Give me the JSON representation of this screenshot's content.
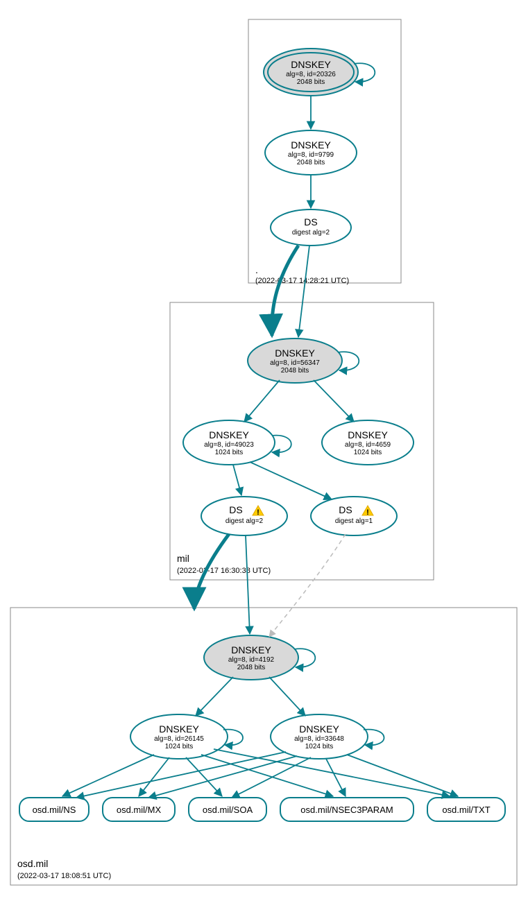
{
  "zones": {
    "root": {
      "label": ".",
      "ts": "(2022-03-17 14:28:21 UTC)"
    },
    "mil": {
      "label": "mil",
      "ts": "(2022-03-17 16:30:38 UTC)"
    },
    "osd": {
      "label": "osd.mil",
      "ts": "(2022-03-17 18:08:51 UTC)"
    }
  },
  "nodes": {
    "root_ksk": {
      "title": "DNSKEY",
      "l1": "alg=8, id=20326",
      "l2": "2048 bits"
    },
    "root_zsk": {
      "title": "DNSKEY",
      "l1": "alg=8, id=9799",
      "l2": "2048 bits"
    },
    "root_ds": {
      "title": "DS",
      "l1": "digest alg=2"
    },
    "mil_ksk": {
      "title": "DNSKEY",
      "l1": "alg=8, id=56347",
      "l2": "2048 bits"
    },
    "mil_zsk": {
      "title": "DNSKEY",
      "l1": "alg=8, id=49023",
      "l2": "1024 bits"
    },
    "mil_zsk2": {
      "title": "DNSKEY",
      "l1": "alg=8, id=4659",
      "l2": "1024 bits"
    },
    "mil_ds2": {
      "title": "DS",
      "l1": "digest alg=2"
    },
    "mil_ds1": {
      "title": "DS",
      "l1": "digest alg=1"
    },
    "osd_ksk": {
      "title": "DNSKEY",
      "l1": "alg=8, id=4192",
      "l2": "2048 bits"
    },
    "osd_zsk1": {
      "title": "DNSKEY",
      "l1": "alg=8, id=26145",
      "l2": "1024 bits"
    },
    "osd_zsk2": {
      "title": "DNSKEY",
      "l1": "alg=8, id=33648",
      "l2": "1024 bits"
    }
  },
  "rr": {
    "ns": "osd.mil/NS",
    "mx": "osd.mil/MX",
    "soa": "osd.mil/SOA",
    "nsec": "osd.mil/NSEC3PARAM",
    "txt": "osd.mil/TXT"
  },
  "colors": {
    "stroke": "#0a7e8c",
    "ksk_fill": "#d9d9d9"
  }
}
